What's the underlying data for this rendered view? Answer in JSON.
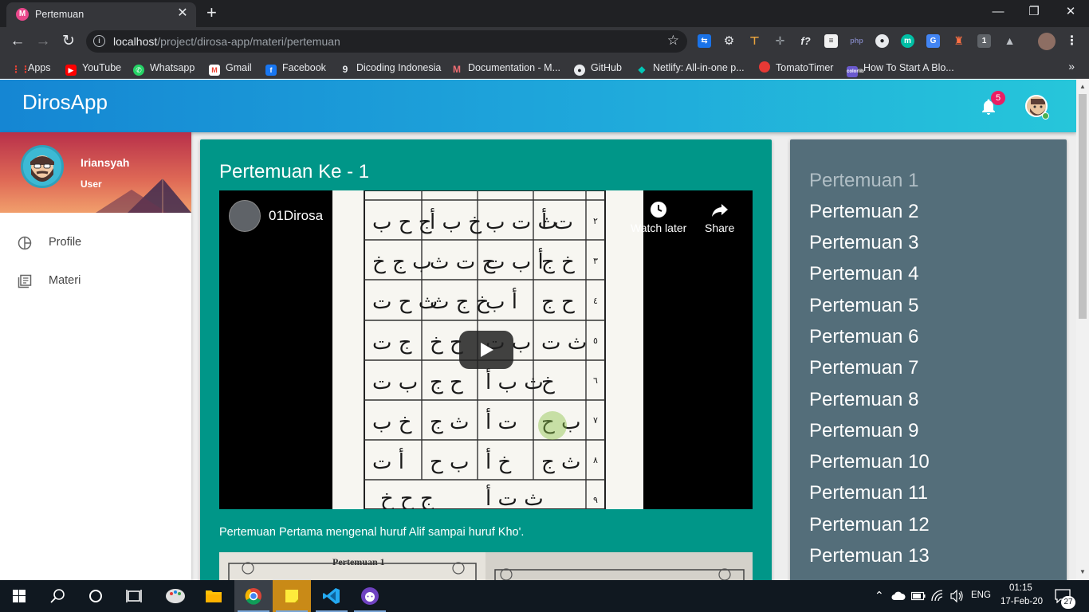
{
  "browser": {
    "tab_title": "Pertemuan",
    "tab_close": "✕",
    "new_tab": "+",
    "url_host": "localhost",
    "url_path": "/project/dirosa-app/materi/pertemuan",
    "window_controls": [
      "—",
      "❐",
      "✕"
    ],
    "bookmarks": [
      {
        "label": "Apps",
        "icon": "apps-grid-icon",
        "color": "#e8eaed"
      },
      {
        "label": "YouTube",
        "icon": "youtube-icon",
        "color": "#ff0000"
      },
      {
        "label": "Whatsapp",
        "icon": "whatsapp-icon",
        "color": "#25d366"
      },
      {
        "label": "Gmail",
        "icon": "gmail-icon",
        "color": "#ea4335"
      },
      {
        "label": "Facebook",
        "icon": "facebook-icon",
        "color": "#1877f2"
      },
      {
        "label": "Dicoding Indonesia",
        "icon": "dicoding-icon",
        "color": "#e8eaed"
      },
      {
        "label": "Documentation - M...",
        "icon": "materialize-icon",
        "color": "#ee6e73"
      },
      {
        "label": "GitHub",
        "icon": "github-icon",
        "color": "#e8eaed"
      },
      {
        "label": "Netlify: All-in-one p...",
        "icon": "netlify-icon",
        "color": "#00c7b7"
      },
      {
        "label": "TomatoTimer",
        "icon": "tomato-icon",
        "color": "#e53935"
      },
      {
        "label": "How To Start A Blo...",
        "icon": "blog-icon",
        "color": "#6a5acd"
      }
    ],
    "bookmarks_more": "»"
  },
  "app": {
    "brand": "DirosApp",
    "notification_count": "5",
    "accent_color": "#009688",
    "user": {
      "name": "Iriansyah",
      "role": "User"
    },
    "menu": [
      {
        "label": "Profile",
        "icon": "profile-icon"
      },
      {
        "label": "Materi",
        "icon": "materi-icon"
      }
    ]
  },
  "main": {
    "title": "Pertemuan Ke - 1",
    "video": {
      "channel_title": "01Dirosa",
      "watch_later": "Watch later",
      "share": "Share"
    },
    "description": "Pertemuan Pertama mengenal huruf Alif sampai huruf Kho'.",
    "image_caption": "Pertemuan 1"
  },
  "sidebar_list": {
    "items": [
      "Pertemuan 1",
      "Pertemuan 2",
      "Pertemuan 3",
      "Pertemuan 4",
      "Pertemuan 5",
      "Pertemuan 6",
      "Pertemuan 7",
      "Pertemuan 8",
      "Pertemuan 9",
      "Pertemuan 10",
      "Pertemuan 11",
      "Pertemuan 12",
      "Pertemuan 13"
    ],
    "active_index": 0
  },
  "taskbar": {
    "language": "ENG",
    "time": "01:15",
    "date": "17-Feb-20",
    "notification_count": "27"
  }
}
